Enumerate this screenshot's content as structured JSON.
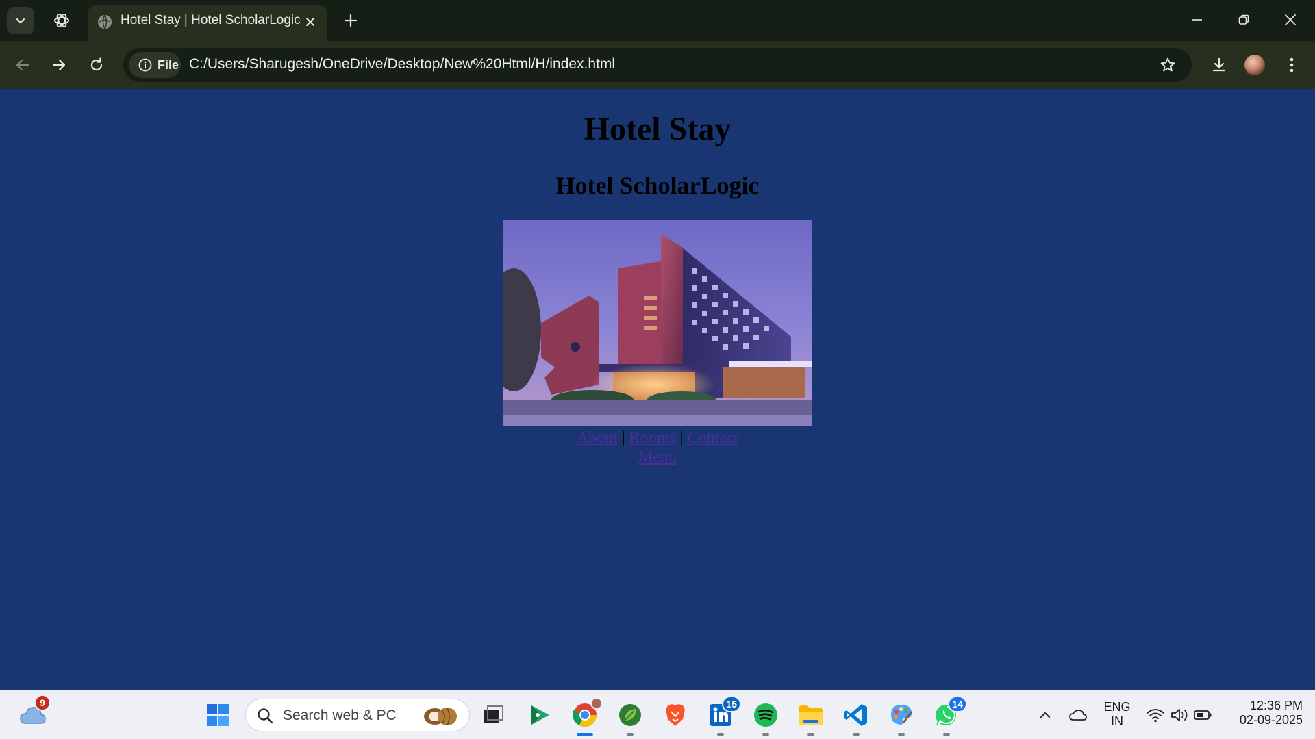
{
  "browser": {
    "tab_title": "Hotel Stay | Hotel ScholarLogic",
    "address_chip_label": "File",
    "url": "C:/Users/Sharugesh/OneDrive/Desktop/New%20Html/H/index.html"
  },
  "page": {
    "heading": "Hotel Stay",
    "subheading": "Hotel ScholarLogic",
    "nav_links": [
      {
        "label": "About"
      },
      {
        "label": "Rooms"
      },
      {
        "label": "Contact"
      },
      {
        "label": "Menu"
      }
    ],
    "separator": "|",
    "background_color": "#1a3672",
    "link_color": "#4b2c9a"
  },
  "taskbar": {
    "weather_badge": "9",
    "search_placeholder": "Search web & PC",
    "linkedin_badge": "15",
    "whatsapp_badge": "14",
    "language_line1": "ENG",
    "language_line2": "IN",
    "time": "12:36 PM",
    "date": "02-09-2025"
  }
}
